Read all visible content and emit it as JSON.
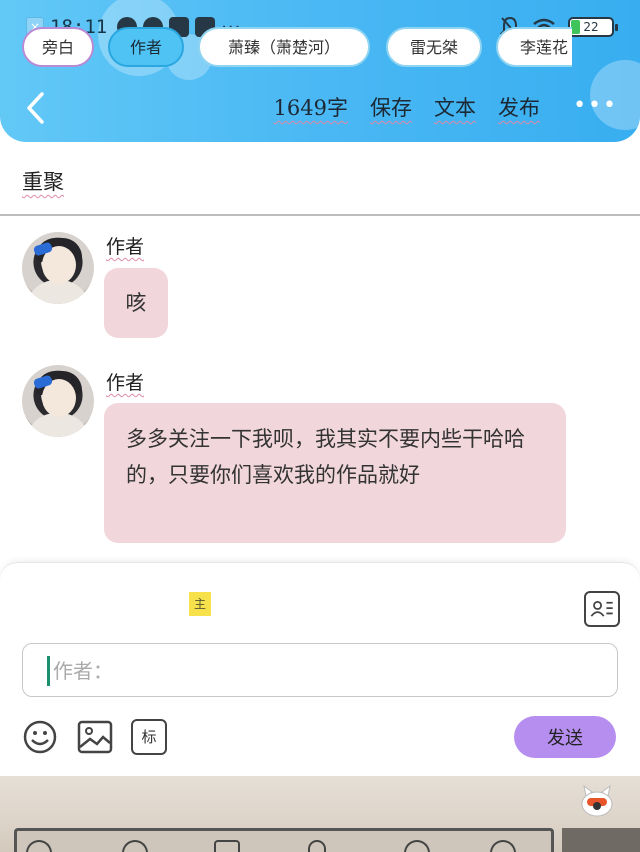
{
  "status_bar": {
    "time": "18:11",
    "battery": "22",
    "dots": "···"
  },
  "toolbar": {
    "word_count": "1649字",
    "save": "保存",
    "text": "文本",
    "publish": "发布",
    "more": "•••"
  },
  "chapter": {
    "title": "重聚"
  },
  "messages": [
    {
      "name": "作者",
      "text": "咳"
    },
    {
      "name": "作者",
      "text": "多多关注一下我呗，我其实不要内些干哈哈的，只要你们喜欢我的作品就好"
    }
  ],
  "roles": {
    "items": [
      "旁白",
      "作者",
      "萧臻（萧楚河）",
      "雷无桀",
      "李莲花"
    ],
    "selected": "作者",
    "main_tag": "主"
  },
  "input": {
    "placeholder": "作者："
  },
  "tools": {
    "tag_label": "标",
    "send": "发送"
  },
  "colors": {
    "header": "#4ab8f4",
    "bubble": "#f1d7dc",
    "selected_role": "#4fc3f4",
    "send": "#b68ef0"
  }
}
